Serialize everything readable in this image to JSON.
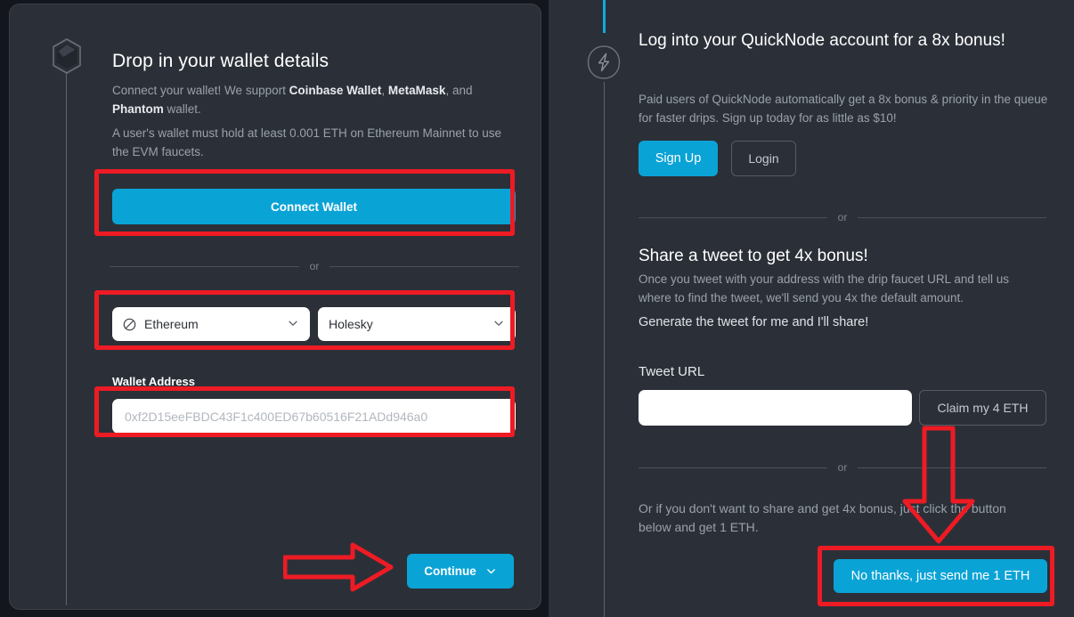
{
  "left": {
    "icon": "wallet-hex-icon",
    "title": "Drop in your wallet details",
    "intro_pre": "Connect your wallet! We support ",
    "wallet_1": "Coinbase Wallet",
    "intro_mid1": ", ",
    "wallet_2": "MetaMask",
    "intro_mid2": ", and ",
    "wallet_3": "Phantom",
    "intro_post": " wallet.",
    "requirement": "A user's wallet must hold at least 0.001 ETH on Ethereum Mainnet to use the EVM faucets.",
    "connect_wallet_label": "Connect Wallet",
    "or_label": "or",
    "chain_select": {
      "value": "Ethereum",
      "icon": "no-entry-circle-icon",
      "chevron": "chevron-down-icon"
    },
    "network_select": {
      "value": "Holesky",
      "chevron": "chevron-down-icon"
    },
    "wallet_address_label": "Wallet Address",
    "wallet_address_value": "",
    "wallet_address_placeholder": "0xf2D15eeFBDC43F1c400ED67b60516F21ADd946a0",
    "continue_label": "Continue",
    "continue_chevron": "chevron-down-icon"
  },
  "right": {
    "icon": "lightning-bolt-hex-icon",
    "title": "Log into your QuickNode account for a 8x bonus!",
    "subtitle": "Paid users of QuickNode automatically get a 8x bonus & priority in the queue for faster drips. Sign up today for as little as $10!",
    "signup_label": "Sign Up",
    "login_label": "Login",
    "or_label": "or",
    "tweet_title": "Share a tweet to get 4x bonus!",
    "tweet_subtitle": "Once you tweet with your address with the drip faucet URL and tell us where to find the tweet, we'll send you 4x the default amount.",
    "generate_tweet_link": "Generate the tweet for me and I'll share!",
    "tweet_url_label": "Tweet URL",
    "tweet_url_value": "",
    "tweet_url_placeholder": "",
    "claim_label": "Claim my 4 ETH",
    "or_label_2": "or",
    "no_share_text": "Or if you don't want to share and get 4x bonus, just click the button below and get 1 ETH.",
    "no_thanks_label": "No thanks, just send me 1 ETH"
  },
  "colors": {
    "accent_blue": "#0aa3d6",
    "annotation_red": "#ee1b24",
    "card_bg": "#2b3038",
    "page_bg": "#13161c",
    "rail": "#5d636d",
    "rail_accent": "#12a9e0"
  },
  "annotations": {
    "boxes": [
      "connect-wallet-highlight",
      "chain-selects-highlight",
      "wallet-address-highlight",
      "no-thanks-highlight"
    ],
    "arrows": [
      "continue-arrow-right",
      "no-thanks-arrow-down"
    ]
  }
}
